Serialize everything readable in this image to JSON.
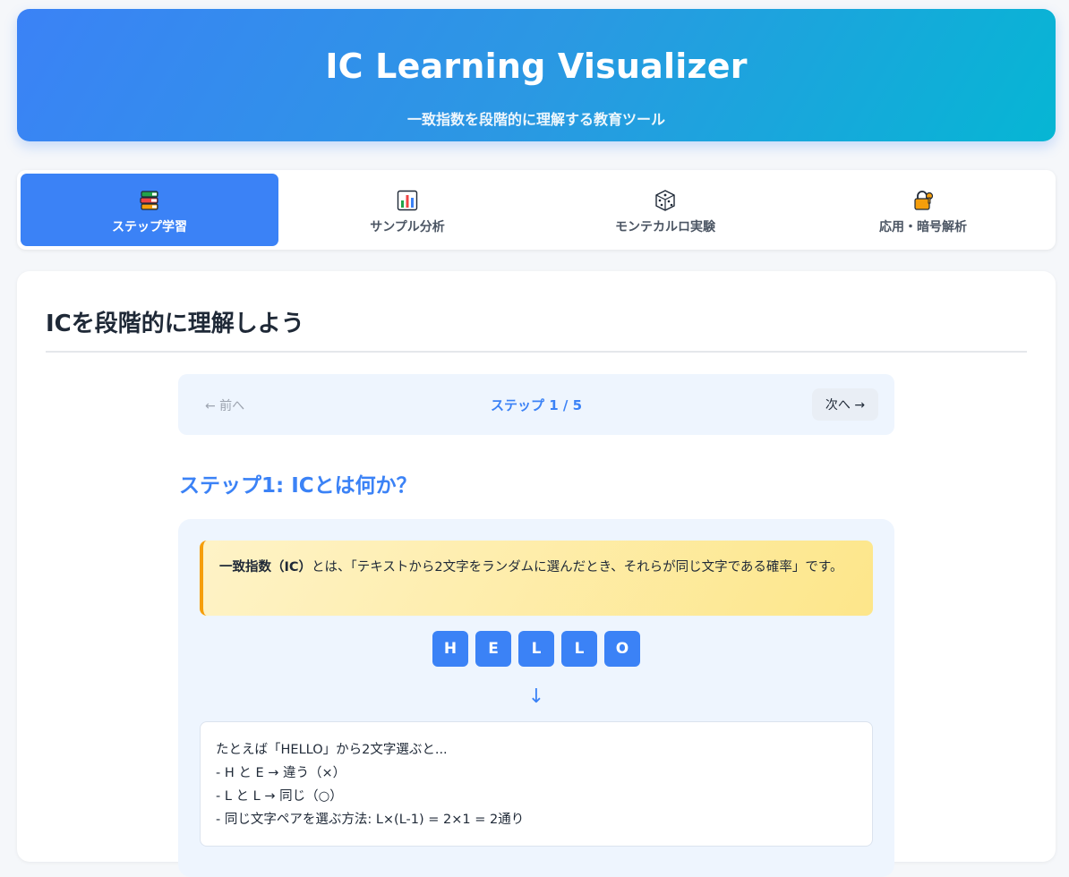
{
  "header": {
    "title": "IC Learning Visualizer",
    "subtitle": "一致指数を段階的に理解する教育ツール"
  },
  "tabs": [
    {
      "icon": "books-icon",
      "label": "ステップ学習",
      "active": true
    },
    {
      "icon": "bar-chart-icon",
      "label": "サンプル分析",
      "active": false
    },
    {
      "icon": "dice-icon",
      "label": "モンテカルロ実験",
      "active": false
    },
    {
      "icon": "lock-key-icon",
      "label": "応用・暗号解析",
      "active": false
    }
  ],
  "main": {
    "title": "ICを段階的に理解しよう",
    "nav": {
      "prev_label": "← 前へ",
      "counter": "ステップ 1 / 5",
      "next_label": "次へ →"
    },
    "step_title": "ステップ1: ICとは何か？",
    "callout": {
      "term": "一致指数（IC）",
      "text": "とは、「テキストから2文字をランダムに選んだとき、それらが同じ文字である確率」です。"
    },
    "letters": [
      "H",
      "E",
      "L",
      "L",
      "O"
    ],
    "arrow": "↓",
    "example_lines": [
      "たとえば「HELLO」から2文字選ぶと...",
      "- H と E → 違う（×）",
      "- L と L → 同じ（○）",
      "- 同じ文字ペアを選ぶ方法: L×(L-1) = 2×1 = 2通り"
    ]
  },
  "colors": {
    "accent": "#3b82f6",
    "header_gradient_start": "#3b82f6",
    "header_gradient_end": "#06b6d4",
    "callout_border": "#f59e0b"
  }
}
